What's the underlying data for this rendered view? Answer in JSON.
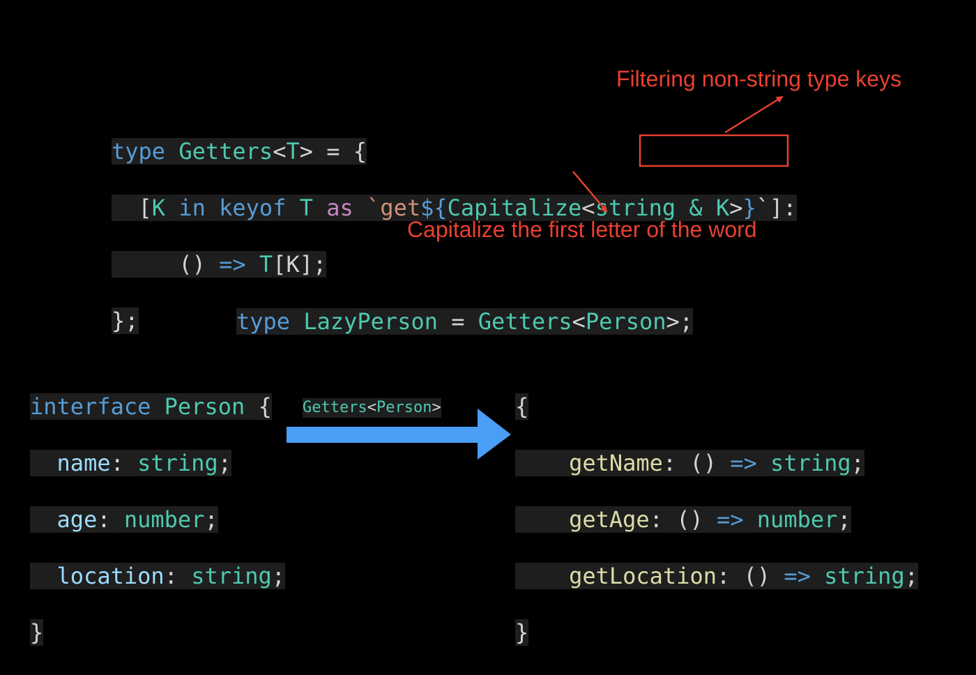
{
  "annotations": {
    "filter_note": "Filtering non-string type keys",
    "capitalize_note": "Capitalize the first letter of the word"
  },
  "getters": {
    "l1": {
      "type_kw": "type",
      "name": "Getters",
      "lt": "<",
      "param": "T",
      "rest": "> = {"
    },
    "l2": {
      "indent": "  ",
      "open": "[",
      "k": "K",
      "in_kw": " in ",
      "keyof_kw": "keyof",
      "t": " T ",
      "as_kw": "as",
      "tick_get": " `get",
      "dollar": "${",
      "cap": "Capitalize",
      "lt": "<",
      "boxed": "string & K",
      "gt": ">",
      "close_brace": "}",
      "tail": "`]:"
    },
    "l3": {
      "indent": "     ",
      "parens": "() ",
      "arrow": "=>",
      "t": " T",
      "bk": "[K];"
    },
    "l4": {
      "close": "};"
    }
  },
  "lazy": {
    "type_kw": "type",
    "name": " LazyPerson",
    "eq": " = ",
    "getters": "Getters",
    "lt": "<",
    "person": "Person",
    "end": ">;"
  },
  "person_interface": {
    "l1": {
      "kw": "interface",
      "name": " Person",
      "brace": " {"
    },
    "fields": [
      {
        "name": "name",
        "colon": ": ",
        "type": "string",
        "semi": ";"
      },
      {
        "name": "age",
        "colon": ": ",
        "type": "number",
        "semi": ";"
      },
      {
        "name": "location",
        "colon": ": ",
        "type": "string",
        "semi": ";"
      }
    ],
    "close": "}"
  },
  "transform_label": {
    "getters": "Getters",
    "lt": "<",
    "person": "Person",
    "gt": ">"
  },
  "result": {
    "open": "{",
    "methods": [
      {
        "name": "getName",
        "colon": ": ",
        "parens": "() ",
        "arrow": "=>",
        "type": " string",
        "semi": ";"
      },
      {
        "name": "getAge",
        "colon": ": ",
        "parens": "() ",
        "arrow": "=>",
        "type": " number",
        "semi": ";"
      },
      {
        "name": "getLocation",
        "colon": ": ",
        "parens": "() ",
        "arrow": "=>",
        "type": " string",
        "semi": ";"
      }
    ],
    "close": "}"
  },
  "colors": {
    "background": "#000000",
    "annotation": "#e8412f",
    "arrow_fill": "#4a9ef5",
    "code_bg": "#1e1e1e"
  }
}
